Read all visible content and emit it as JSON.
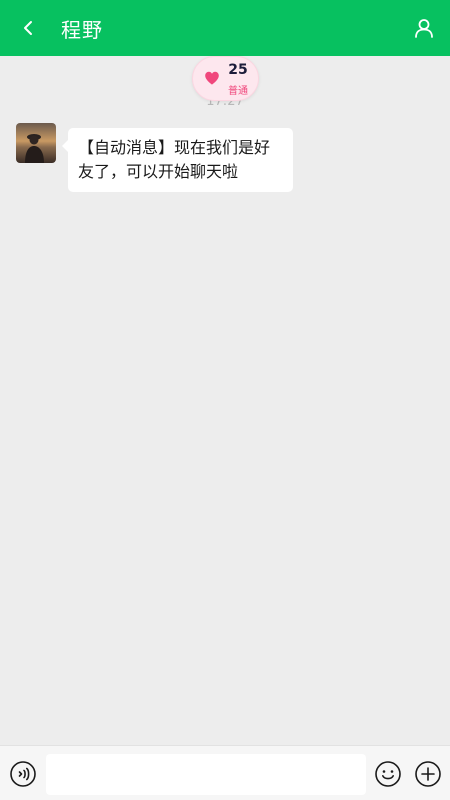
{
  "header": {
    "title": "程野",
    "back_icon": "chevron-left-icon",
    "profile_icon": "user-icon",
    "color": "#07c160"
  },
  "intimacy": {
    "count": "25",
    "level": "普通",
    "icon": "heart-icon",
    "heart_color": "#f0477c"
  },
  "chat": {
    "timestamp": "17:27",
    "messages": [
      {
        "sender": "other",
        "avatar_icon": "avatar-photo",
        "text": "【自动消息】现在我们是好友了，可以开始聊天啦"
      }
    ]
  },
  "input_bar": {
    "voice_icon": "voice-icon",
    "input_value": "",
    "emoji_icon": "emoji-icon",
    "plus_icon": "plus-icon"
  }
}
